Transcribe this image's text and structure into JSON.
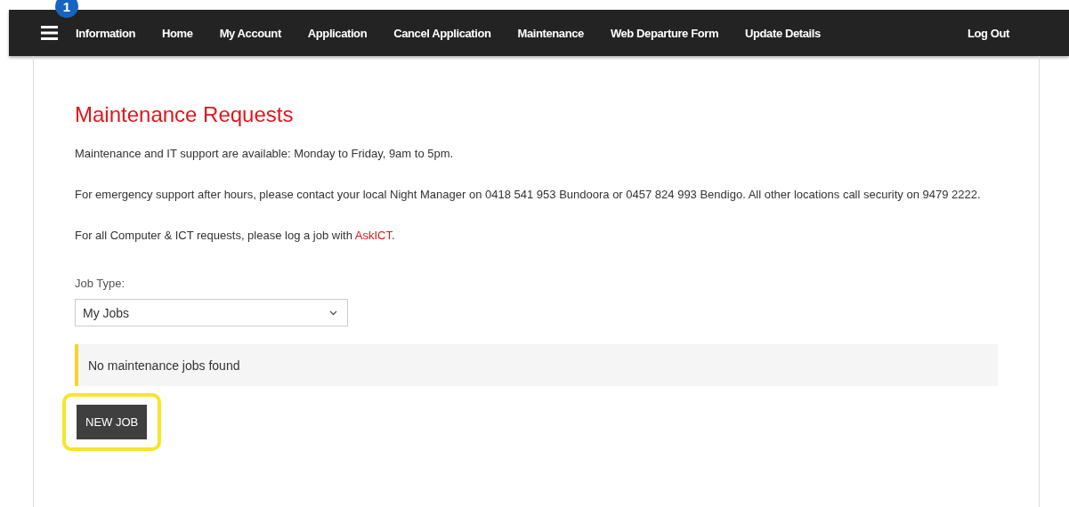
{
  "nav": {
    "badge": "1",
    "items": [
      {
        "label": "Information"
      },
      {
        "label": "Home"
      },
      {
        "label": "My Account"
      },
      {
        "label": "Application"
      },
      {
        "label": "Cancel Application"
      },
      {
        "label": "Maintenance"
      },
      {
        "label": "Web Departure Form"
      },
      {
        "label": "Update Details"
      }
    ],
    "logout": "Log Out"
  },
  "page": {
    "title": "Maintenance Requests",
    "paragraphs": [
      {
        "text": "Maintenance and IT support are available: Monday to Friday, 9am to 5pm."
      },
      {
        "text": "For emergency support after hours, please contact your local Night Manager on 0418 541 953 Bundoora or 0457 824 993 Bendigo. All other locations call security on 9479 2222."
      },
      {
        "text": "For all Computer & ICT requests, please log a job with ",
        "link": "AskICT",
        "after": "."
      }
    ],
    "job_type": {
      "label": "Job Type:",
      "value": "My Jobs"
    },
    "notice": "No maintenance jobs found",
    "new_job_button": {
      "label": "NEW JOB",
      "highlighted": true
    }
  }
}
